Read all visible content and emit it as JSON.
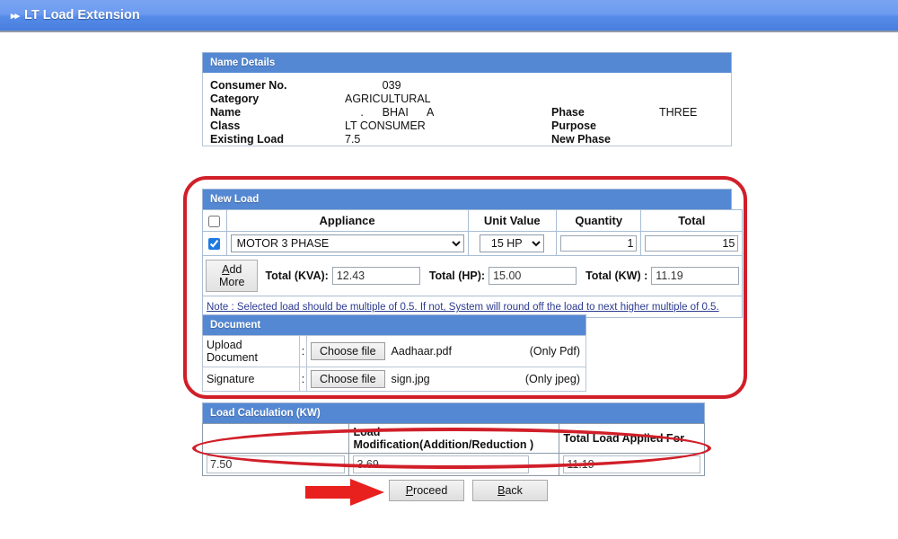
{
  "topbar": {
    "arrows": "▸▸",
    "title": "LT Load Extension"
  },
  "name_details": {
    "heading": "Name Details",
    "rows": [
      {
        "label": "Consumer No.",
        "value": "            039"
      },
      {
        "label": "Category",
        "value": "AGRICULTURAL"
      },
      {
        "label": "Name",
        "value": "     .      BHAI      A",
        "label2": "Phase",
        "value2": "THREE"
      },
      {
        "label": "Class",
        "value": "LT CONSUMER",
        "label2": "Purpose",
        "value2": ""
      },
      {
        "label": "Existing Load",
        "value": "7.5",
        "label2": "New Phase",
        "value2": ""
      }
    ]
  },
  "new_load": {
    "heading": "New Load",
    "columns": [
      "",
      "Appliance",
      "Unit Value",
      "Quantity",
      "Total"
    ],
    "select_all_checked": false,
    "rows": [
      {
        "checked": true,
        "appliance": "MOTOR 3 PHASE",
        "appliance_options": [
          "MOTOR 3 PHASE"
        ],
        "unit_value": "15 HP",
        "unit_options": [
          "15 HP"
        ],
        "quantity": "1",
        "total": "15"
      }
    ],
    "add_more_label": "Add More",
    "add_more_accel": "A",
    "totals": [
      {
        "label": "Total (KVA):",
        "value": "12.43"
      },
      {
        "label": "Total (HP):",
        "value": "15.00"
      },
      {
        "label": "Total (KW) :",
        "value": "11.19"
      }
    ],
    "note": "Note : Selected load should be multiple of 0.5. If not, System will round off the load to next higher multiple of 0.5."
  },
  "document": {
    "heading": "Document",
    "rows": [
      {
        "label": "Upload Document",
        "colon": ":",
        "button": "Choose file",
        "file": "Aadhaar.pdf",
        "hint": "(Only Pdf)"
      },
      {
        "label": "Signature",
        "colon": ":",
        "button": "Choose file",
        "file": "sign.jpg",
        "hint": "(Only jpeg)"
      }
    ]
  },
  "load_calculation": {
    "heading": "Load Calculation (KW)",
    "columns": [
      "",
      "Load Modification(Addition/Reduction )",
      "Total Load Applied For"
    ],
    "values": [
      "7.50",
      "3.69",
      "11.19"
    ]
  },
  "actions": {
    "proceed_label": "Proceed",
    "proceed_accel": "P",
    "back_label": "Back",
    "back_accel": "B"
  },
  "annotations": {
    "highlight_color": "#d11f29",
    "arrow_color": "#e8201e",
    "box_target": "new-load-and-document",
    "ellipse_target": "load-calculation-row",
    "arrow_target": "proceed-button"
  }
}
